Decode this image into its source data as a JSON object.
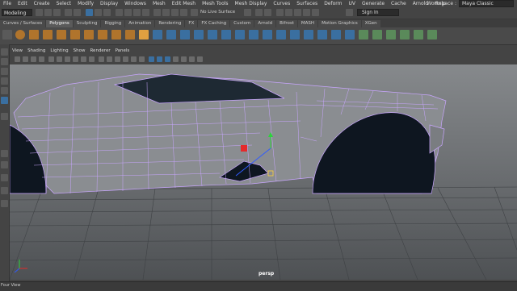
{
  "menu": [
    "Edit",
    "Create",
    "Select",
    "Modify",
    "Display",
    "Windows",
    "Mesh",
    "Edit Mesh",
    "Mesh Tools",
    "Mesh Display",
    "Curves",
    "Surfaces",
    "Deform",
    "UV",
    "Generate",
    "Cache",
    "Arnold",
    "Help"
  ],
  "file_menu": "File",
  "workspace": {
    "label": "Workspace :",
    "value": "Maya Classic"
  },
  "mode_selector": "Modeling",
  "live_surface": "No Live Surface",
  "sign_in": "Sign In",
  "shelf_tabs": [
    "Curves / Surfaces",
    "Polygons",
    "Sculpting",
    "Rigging",
    "Animation",
    "Rendering",
    "FX",
    "FX Caching",
    "Custom",
    "Arnold",
    "Bifrost",
    "MASH",
    "Motion Graphics",
    "XGen"
  ],
  "active_shelf_tab": "Polygons",
  "panel_menu": [
    "View",
    "Shading",
    "Lighting",
    "Show",
    "Renderer",
    "Panels"
  ],
  "camera_label": "persp",
  "bottom_label": "Four View",
  "colors": {
    "ui_bg": "#444444",
    "shelf_blue": "#3a6fa0",
    "shelf_orange": "#b0742c",
    "wire": "#c9a6ff",
    "manip_red": "#e52a2a",
    "manip_green": "#2bd43a",
    "manip_blue": "#2f5bff"
  },
  "icons": [
    "select-tool-icon",
    "lasso-tool-icon",
    "paint-select-icon",
    "move-tool-icon",
    "rotate-tool-icon",
    "scale-tool-icon",
    "sphere-icon",
    "cube-icon",
    "cylinder-icon",
    "cone-icon",
    "torus-icon",
    "plane-icon",
    "grid-icon",
    "camera-icon"
  ]
}
